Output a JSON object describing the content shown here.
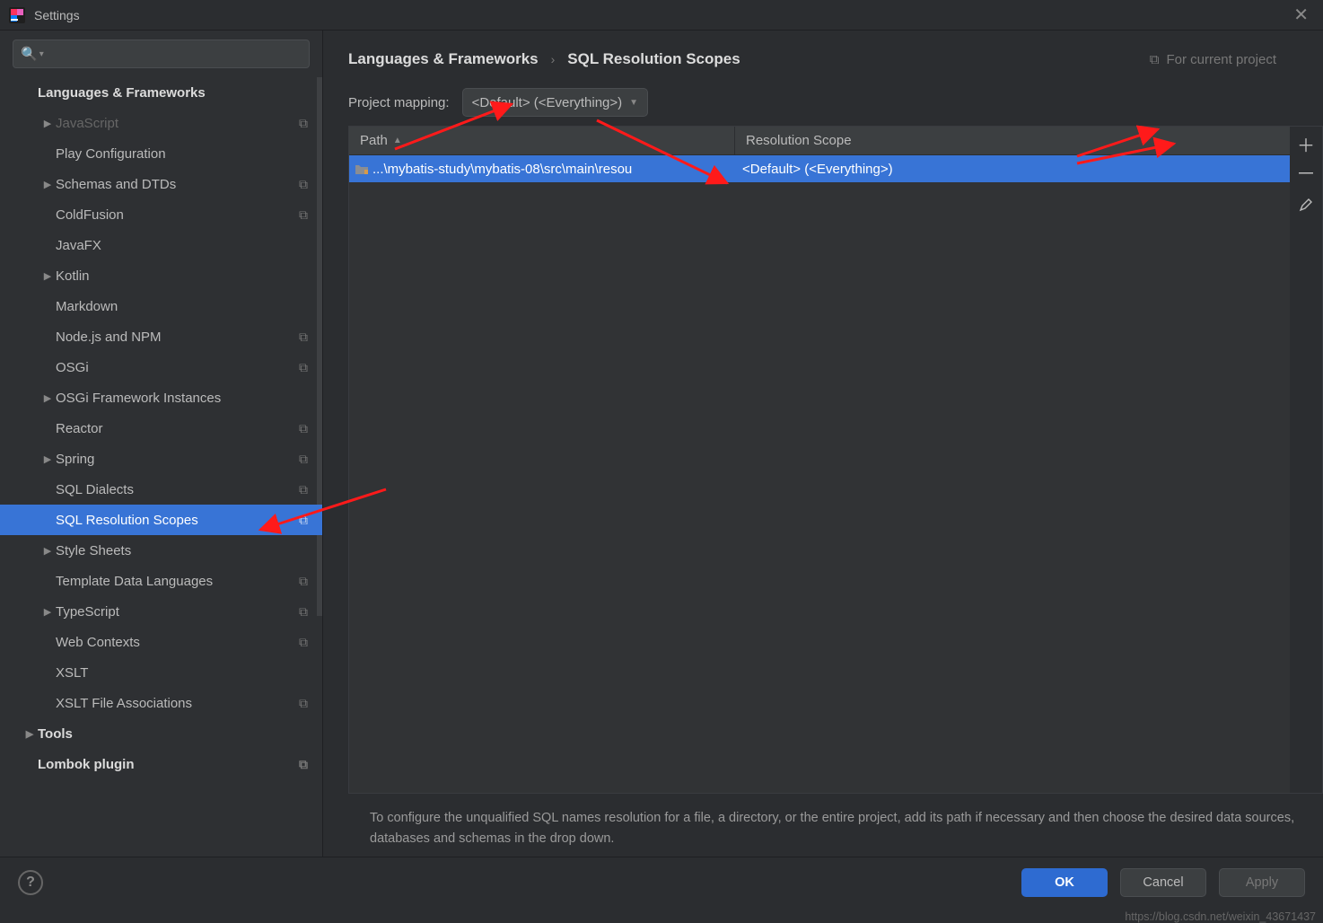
{
  "window": {
    "title": "Settings"
  },
  "sidebar": {
    "section_header": "Languages & Frameworks",
    "items": [
      {
        "label": "JavaScript",
        "level": 2,
        "caret": true,
        "copy": true,
        "dim": true
      },
      {
        "label": "Play Configuration",
        "level": 2,
        "caret": false,
        "copy": false
      },
      {
        "label": "Schemas and DTDs",
        "level": 2,
        "caret": true,
        "copy": true
      },
      {
        "label": "ColdFusion",
        "level": 2,
        "caret": false,
        "copy": true
      },
      {
        "label": "JavaFX",
        "level": 2,
        "caret": false,
        "copy": false
      },
      {
        "label": "Kotlin",
        "level": 2,
        "caret": true,
        "copy": false
      },
      {
        "label": "Markdown",
        "level": 2,
        "caret": false,
        "copy": false
      },
      {
        "label": "Node.js and NPM",
        "level": 2,
        "caret": false,
        "copy": true
      },
      {
        "label": "OSGi",
        "level": 2,
        "caret": false,
        "copy": true
      },
      {
        "label": "OSGi Framework Instances",
        "level": 2,
        "caret": true,
        "copy": false
      },
      {
        "label": "Reactor",
        "level": 2,
        "caret": false,
        "copy": true
      },
      {
        "label": "Spring",
        "level": 2,
        "caret": true,
        "copy": true
      },
      {
        "label": "SQL Dialects",
        "level": 2,
        "caret": false,
        "copy": true
      },
      {
        "label": "SQL Resolution Scopes",
        "level": 2,
        "caret": false,
        "copy": true,
        "selected": true
      },
      {
        "label": "Style Sheets",
        "level": 2,
        "caret": true,
        "copy": false
      },
      {
        "label": "Template Data Languages",
        "level": 2,
        "caret": false,
        "copy": true
      },
      {
        "label": "TypeScript",
        "level": 2,
        "caret": true,
        "copy": true
      },
      {
        "label": "Web Contexts",
        "level": 2,
        "caret": false,
        "copy": true
      },
      {
        "label": "XSLT",
        "level": 2,
        "caret": false,
        "copy": false
      },
      {
        "label": "XSLT File Associations",
        "level": 2,
        "caret": false,
        "copy": true
      }
    ],
    "footer_items": [
      {
        "label": "Tools",
        "level": 1,
        "caret": true,
        "bold": true
      },
      {
        "label": "Lombok plugin",
        "level": 1,
        "caret": false,
        "bold": true,
        "copy": true
      }
    ]
  },
  "breadcrumb": {
    "c1": "Languages & Frameworks",
    "c2": "SQL Resolution Scopes",
    "project_note": "For current project"
  },
  "mapping": {
    "label": "Project mapping:",
    "value": "<Default> (<Everything>)"
  },
  "table": {
    "cols": {
      "path": "Path",
      "scope": "Resolution Scope"
    },
    "row": {
      "path": "...\\mybatis-study\\mybatis-08\\src\\main\\resou",
      "scope": "<Default> (<Everything>)"
    }
  },
  "hint": "To configure the unqualified SQL names resolution for a file, a directory, or the entire project, add its path if necessary and then choose the desired data sources, databases and schemas in the drop down.",
  "buttons": {
    "ok": "OK",
    "cancel": "Cancel",
    "apply": "Apply"
  },
  "watermark": "https://blog.csdn.net/weixin_43671437"
}
